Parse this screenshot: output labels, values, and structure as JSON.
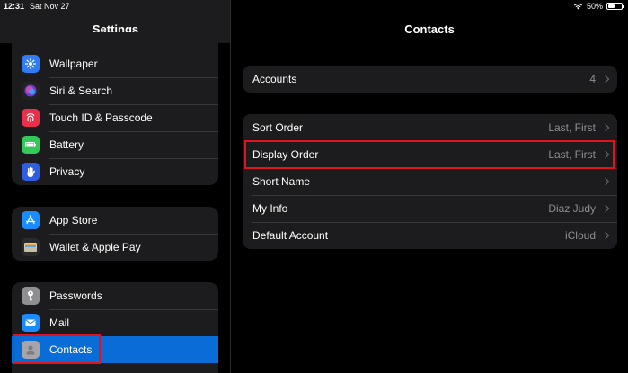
{
  "status_bar": {
    "time": "12:31",
    "date": "Sat Nov 27",
    "battery": "50%",
    "battery_level": 0.5
  },
  "sidebar": {
    "title": "Settings",
    "groups": [
      {
        "items": [
          {
            "label": "Wallpaper",
            "icon": "wallpaper-icon",
            "color": "#2f7cf6"
          },
          {
            "label": "Siri & Search",
            "icon": "siri-icon",
            "color": "#222222"
          },
          {
            "label": "Touch ID & Passcode",
            "icon": "fingerprint-icon",
            "color": "#e8304b"
          },
          {
            "label": "Battery",
            "icon": "battery-icon",
            "color": "#34c759"
          },
          {
            "label": "Privacy",
            "icon": "hand-icon",
            "color": "#2f5fe0"
          }
        ]
      },
      {
        "items": [
          {
            "label": "App Store",
            "icon": "app-store-icon",
            "color": "#1a8cff"
          },
          {
            "label": "Wallet & Apple Pay",
            "icon": "wallet-icon",
            "color": "#2b2b2b"
          }
        ]
      },
      {
        "items": [
          {
            "label": "Passwords",
            "icon": "key-icon",
            "color": "#8e8e93"
          },
          {
            "label": "Mail",
            "icon": "mail-icon",
            "color": "#1a8cff"
          },
          {
            "label": "Contacts",
            "icon": "contacts-icon",
            "color": "#a6a6aa",
            "selected": true
          }
        ]
      }
    ]
  },
  "detail": {
    "title": "Contacts",
    "accounts": {
      "label": "Accounts",
      "value": "4"
    },
    "settings": [
      {
        "label": "Sort Order",
        "value": "Last, First"
      },
      {
        "label": "Display Order",
        "value": "Last, First"
      },
      {
        "label": "Short Name",
        "value": ""
      },
      {
        "label": "My Info",
        "value": "Diaz Judy"
      },
      {
        "label": "Default Account",
        "value": "iCloud"
      }
    ]
  }
}
